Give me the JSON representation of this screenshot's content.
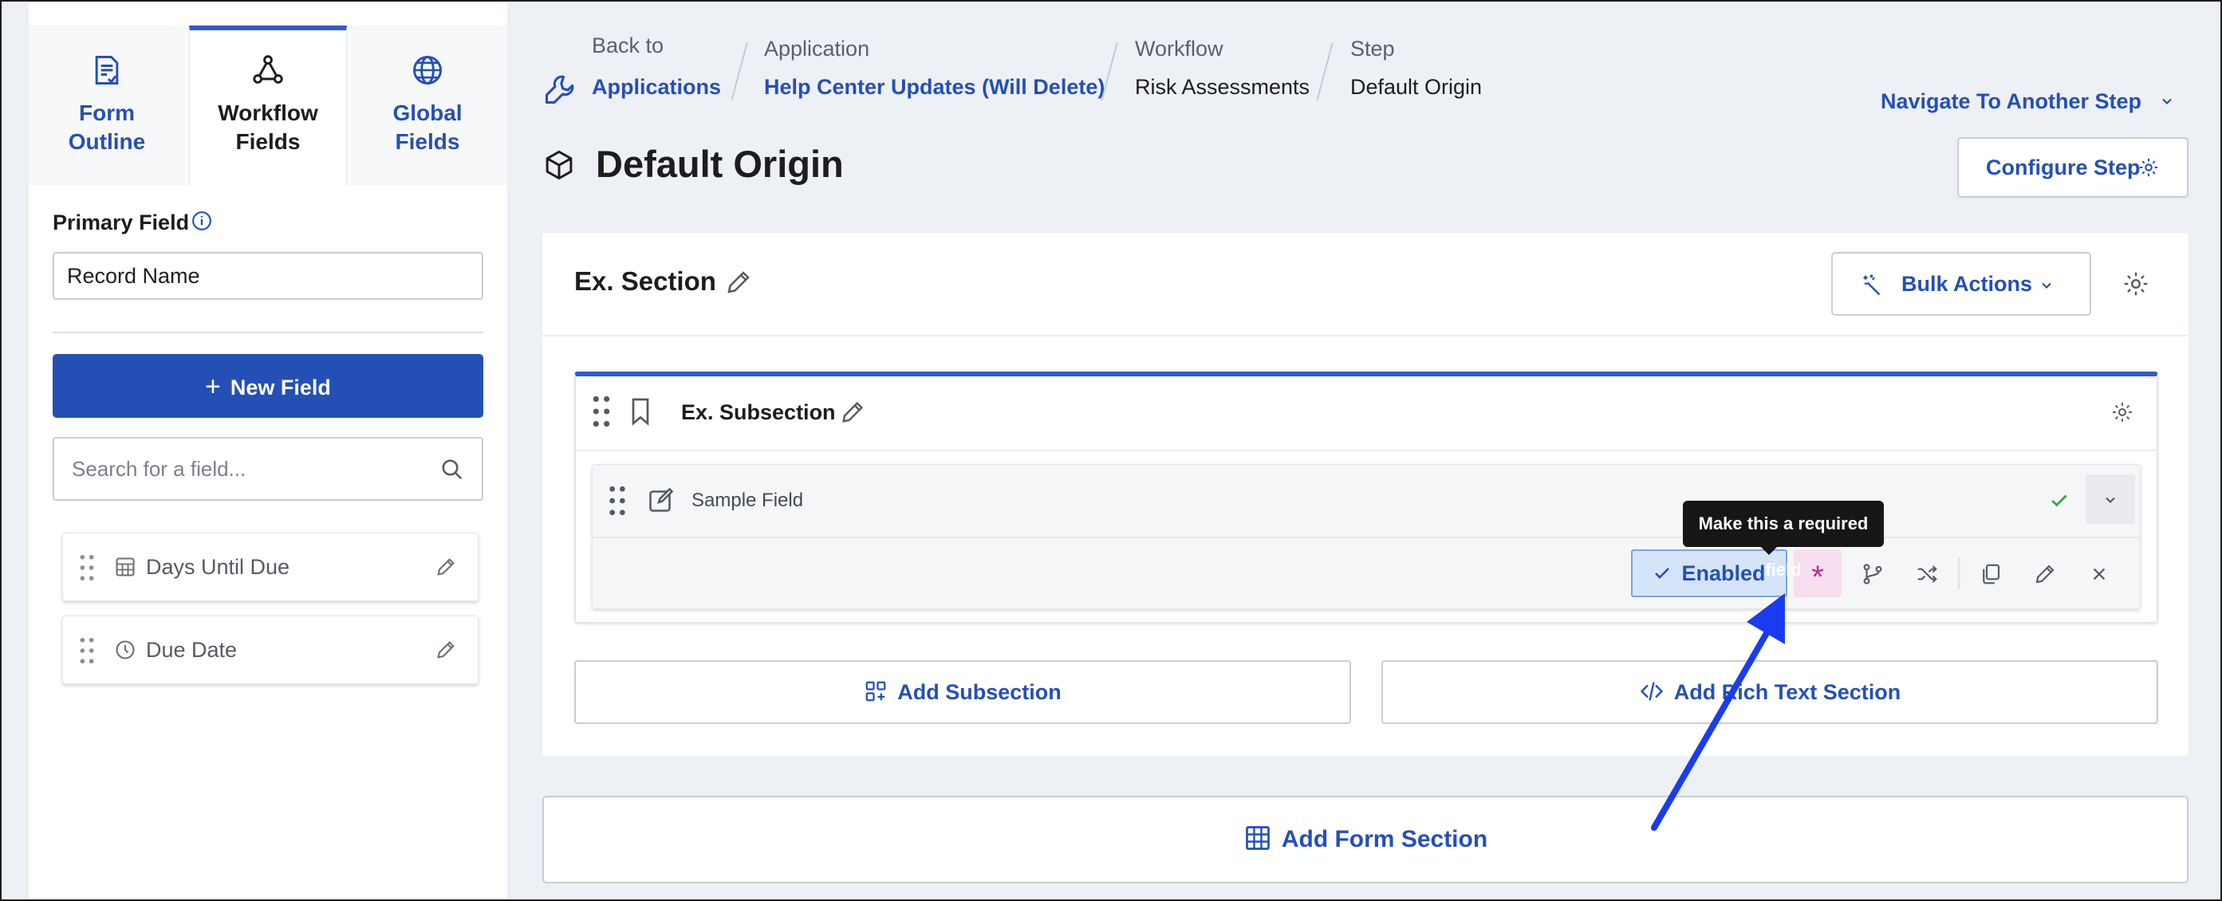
{
  "sidebar": {
    "tabs": [
      {
        "line1": "Form",
        "line2": "Outline",
        "icon": "form-outline-icon"
      },
      {
        "line1": "Workflow",
        "line2": "Fields",
        "icon": "workflow-icon"
      },
      {
        "line1": "Global",
        "line2": "Fields",
        "icon": "globe-icon"
      }
    ],
    "primary_field_label": "Primary Field",
    "primary_field_value": "Record Name",
    "new_field_label": "New Field",
    "search_placeholder": "Search for a field...",
    "fields": [
      {
        "name": "Days Until Due",
        "icon": "calculator-icon"
      },
      {
        "name": "Due Date",
        "icon": "clock-icon"
      }
    ]
  },
  "breadcrumb": {
    "back_label": "Back to",
    "back_link": "Applications",
    "application_label": "Application",
    "application_value": "Help Center Updates (Will Delete)",
    "workflow_label": "Workflow",
    "workflow_value": "Risk Assessments",
    "step_label": "Step",
    "step_value": "Default Origin"
  },
  "header": {
    "navigate_label": "Navigate To Another Step",
    "title": "Default Origin",
    "configure_label": "Configure Step"
  },
  "section": {
    "title": "Ex. Section",
    "bulk_actions_label": "Bulk Actions",
    "subsection": {
      "title": "Ex. Subsection",
      "field": {
        "name": "Sample Field",
        "enabled_label": "Enabled",
        "required_symbol": "*",
        "tooltip": "Make this a required field"
      }
    },
    "add_subsection_label": "Add Subsection",
    "add_rich_text_label": "Add Rich Text Section"
  },
  "add_form_section_label": "Add Form Section",
  "colors": {
    "primary": "#2450b6",
    "accent_border": "#2f5ad1",
    "required": "#c7259b",
    "success": "#3aa845",
    "annotation_arrow": "#1a3cf0"
  }
}
